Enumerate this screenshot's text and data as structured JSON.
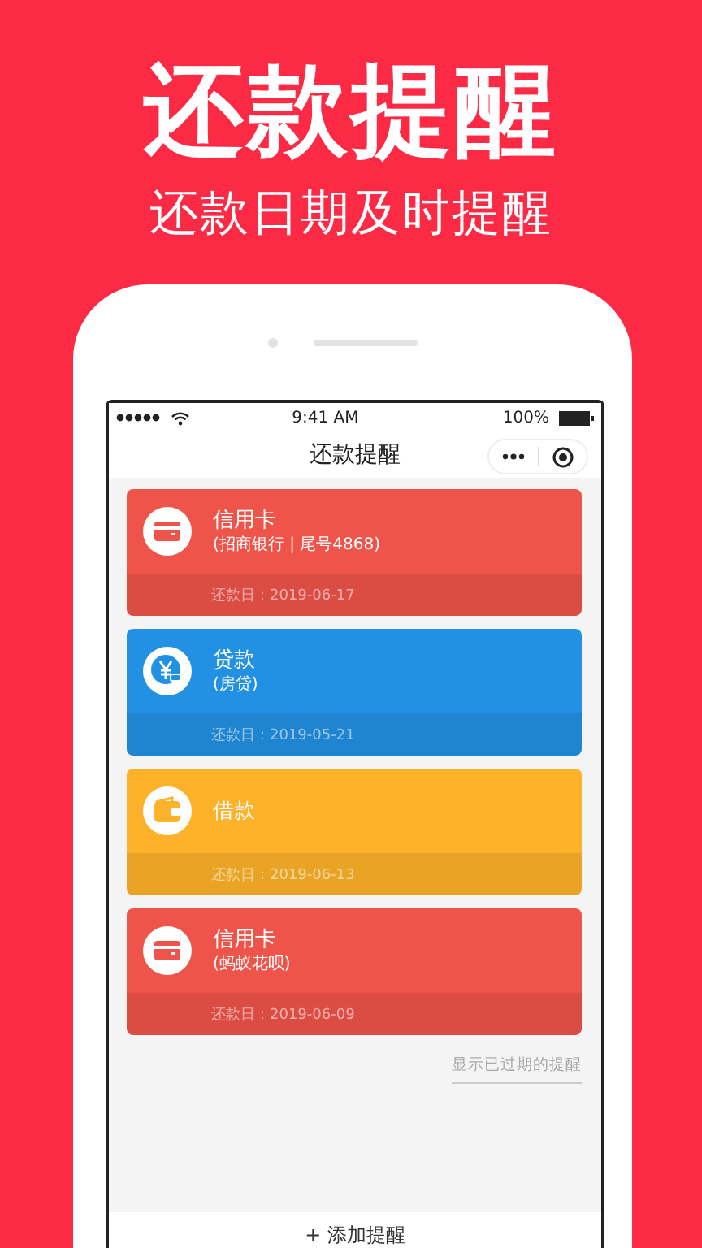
{
  "banner": {
    "title": "还款提醒",
    "subtitle": "还款日期及时提醒"
  },
  "status_bar": {
    "time": "9:41 AM",
    "battery": "100%"
  },
  "nav": {
    "title": "还款提醒"
  },
  "reminders": [
    {
      "kind": "card",
      "title": "信用卡",
      "detail": "(招商银行 | 尾号4868)",
      "due": "还款日：2019-06-17",
      "color": "#ee5449"
    },
    {
      "kind": "loan",
      "title": "贷款",
      "detail": "(房贷)",
      "due": "还款日：2019-05-21",
      "color": "#2391e3"
    },
    {
      "kind": "wallet",
      "title": "借款",
      "due": "还款日：2019-06-13",
      "color": "#fdb229"
    },
    {
      "kind": "card",
      "title": "信用卡",
      "detail": "(蚂蚁花呗)",
      "due": "还款日：2019-06-09",
      "color": "#ee5449"
    }
  ],
  "expired_link": "显示已过期的提醒",
  "add_button": "+ 添加提醒"
}
